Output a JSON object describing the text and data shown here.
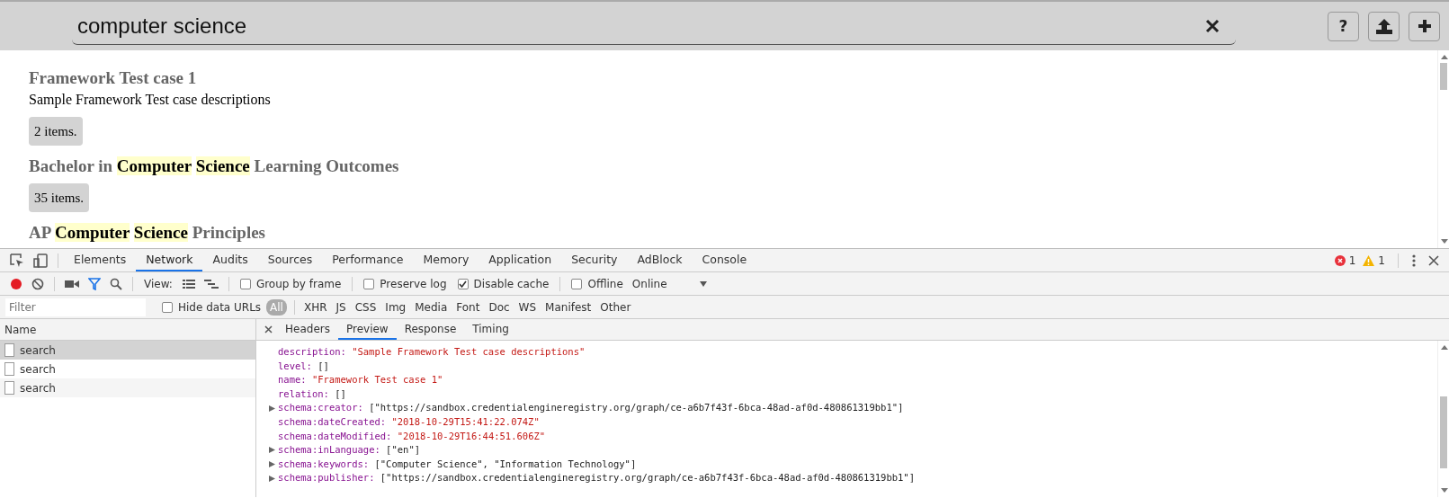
{
  "search": {
    "value": "computer science"
  },
  "header_buttons": [
    {
      "kind": "help",
      "label": "?"
    },
    {
      "kind": "upload"
    },
    {
      "kind": "add"
    }
  ],
  "results": [
    {
      "title": [
        {
          "text": "Framework Test case 1",
          "highlighted": false
        }
      ],
      "description": "Sample Framework Test case descriptions",
      "count": "2 items."
    },
    {
      "title": [
        {
          "text": "Bachelor in ",
          "highlighted": false
        },
        {
          "text": "Computer",
          "highlighted": true
        },
        {
          "text": "Science",
          "highlighted": true
        },
        {
          "text": " Learning Outcomes",
          "highlighted": false
        }
      ],
      "count": "35 items."
    },
    {
      "title": [
        {
          "text": "AP ",
          "highlighted": false
        },
        {
          "text": "Computer",
          "highlighted": true
        },
        {
          "text": "Science",
          "highlighted": true
        },
        {
          "text": " Principles",
          "highlighted": false
        }
      ]
    }
  ],
  "devtools": {
    "tabs": [
      {
        "label": "Elements",
        "selected": false
      },
      {
        "label": "Network",
        "selected": true
      },
      {
        "label": "Audits",
        "selected": false
      },
      {
        "label": "Sources",
        "selected": false
      },
      {
        "label": "Performance",
        "selected": false
      },
      {
        "label": "Memory",
        "selected": false
      },
      {
        "label": "Application",
        "selected": false
      },
      {
        "label": "Security",
        "selected": false
      },
      {
        "label": "AdBlock",
        "selected": false
      },
      {
        "label": "Console",
        "selected": false
      }
    ],
    "errors": "1",
    "warnings": "1",
    "network_toolbar": {
      "recording": true,
      "filter_active": true,
      "view_label": "View:",
      "checkbox_groups": [
        [
          {
            "label": "Group by frame",
            "checked": false
          }
        ],
        [
          {
            "label": "Preserve log",
            "checked": false
          },
          {
            "label": "Disable cache",
            "checked": true
          }
        ],
        [
          {
            "label": "Offline",
            "checked": false
          }
        ]
      ],
      "throttle": "Online"
    },
    "filter": {
      "placeholder": "Filter",
      "hide_data_urls": {
        "label": "Hide data URLs",
        "checked": false
      },
      "types": [
        {
          "label": "All",
          "selected": true
        },
        {
          "label": "XHR",
          "selected": false
        },
        {
          "label": "JS",
          "selected": false
        },
        {
          "label": "CSS",
          "selected": false
        },
        {
          "label": "Img",
          "selected": false
        },
        {
          "label": "Media",
          "selected": false
        },
        {
          "label": "Font",
          "selected": false
        },
        {
          "label": "Doc",
          "selected": false
        },
        {
          "label": "WS",
          "selected": false
        },
        {
          "label": "Manifest",
          "selected": false
        },
        {
          "label": "Other",
          "selected": false
        }
      ]
    },
    "requests": {
      "header": "Name",
      "rows": [
        {
          "name": "search",
          "selected": true
        },
        {
          "name": "search",
          "selected": false
        },
        {
          "name": "search",
          "selected": false
        }
      ]
    },
    "detail_tabs": [
      {
        "label": "Headers",
        "selected": false
      },
      {
        "label": "Preview",
        "selected": true
      },
      {
        "label": "Response",
        "selected": false
      },
      {
        "label": "Timing",
        "selected": false
      }
    ],
    "preview_lines": [
      {
        "key": "description:",
        "value": "\"Sample Framework Test case descriptions\"",
        "kind": "string"
      },
      {
        "key": "level:",
        "value": "[]",
        "kind": "plain"
      },
      {
        "key": "name:",
        "value": "\"Framework Test case 1\"",
        "kind": "string"
      },
      {
        "key": "relation:",
        "value": "[]",
        "kind": "plain"
      },
      {
        "key": "schema:creator:",
        "value": "[\"https://sandbox.credentialengineregistry.org/graph/ce-a6b7f43f-6bca-48ad-af0d-480861319bb1\"]",
        "kind": "plain",
        "expanded": false
      },
      {
        "key": "schema:dateCreated:",
        "value": "\"2018-10-29T15:41:22.074Z\"",
        "kind": "string"
      },
      {
        "key": "schema:dateModified:",
        "value": "\"2018-10-29T16:44:51.606Z\"",
        "kind": "string"
      },
      {
        "key": "schema:inLanguage:",
        "value": "[\"en\"]",
        "kind": "plain",
        "expanded": false
      },
      {
        "key": "schema:keywords:",
        "value": "[\"Computer Science\", \"Information Technology\"]",
        "kind": "plain",
        "expanded": false
      },
      {
        "key": "schema:publisher:",
        "value": "[\"https://sandbox.credentialengineregistry.org/graph/ce-a6b7f43f-6bca-48ad-af0d-480861319bb1\"]",
        "kind": "plain",
        "expanded": false
      }
    ]
  }
}
